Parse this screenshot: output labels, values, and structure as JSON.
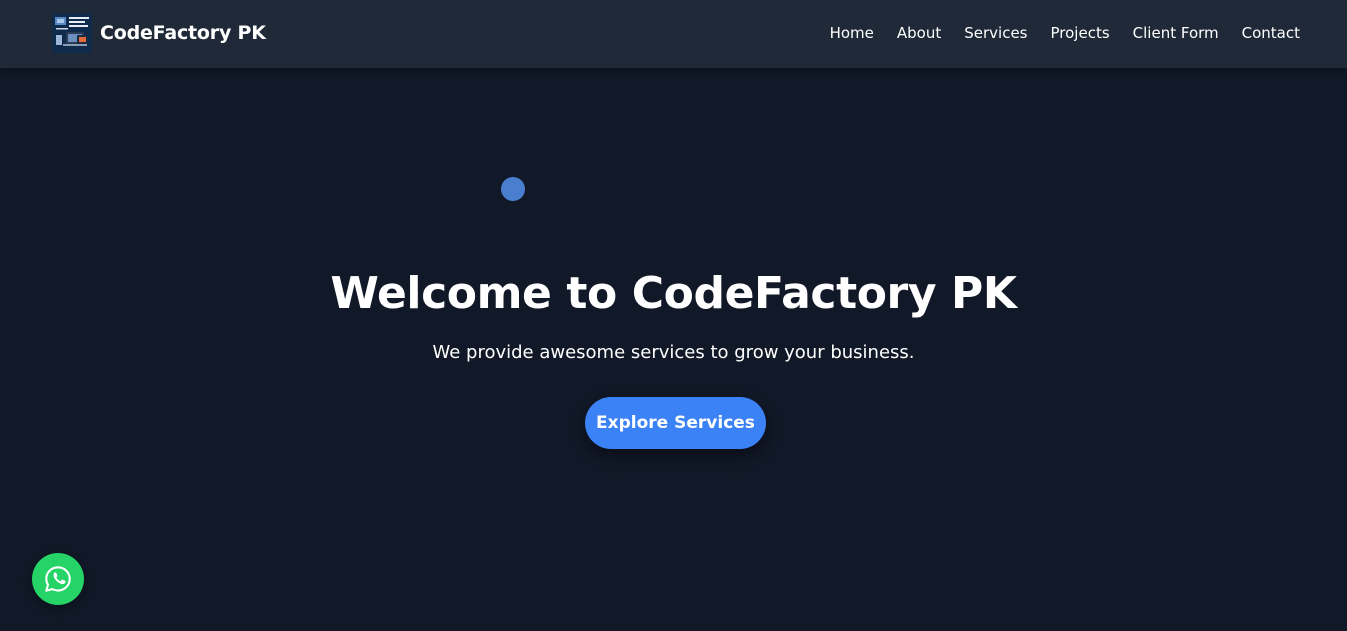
{
  "brand": {
    "name": "CodeFactory PK",
    "logo_icon": "website-development-logo-icon"
  },
  "nav": {
    "items": [
      {
        "label": "Home"
      },
      {
        "label": "About"
      },
      {
        "label": "Services"
      },
      {
        "label": "Projects"
      },
      {
        "label": "Client Form"
      },
      {
        "label": "Contact"
      }
    ]
  },
  "hero": {
    "title": "Welcome to CodeFactory PK",
    "subtitle": "We provide awesome services to grow your business.",
    "cta_label": "Explore Services"
  },
  "floating": {
    "whatsapp_icon": "whatsapp-icon"
  },
  "colors": {
    "page_background": "#111827",
    "navbar_background": "#1f2937",
    "accent": "#3b82f6",
    "whatsapp_green": "#25d366",
    "decorative_dot": "#4a7fd0"
  }
}
